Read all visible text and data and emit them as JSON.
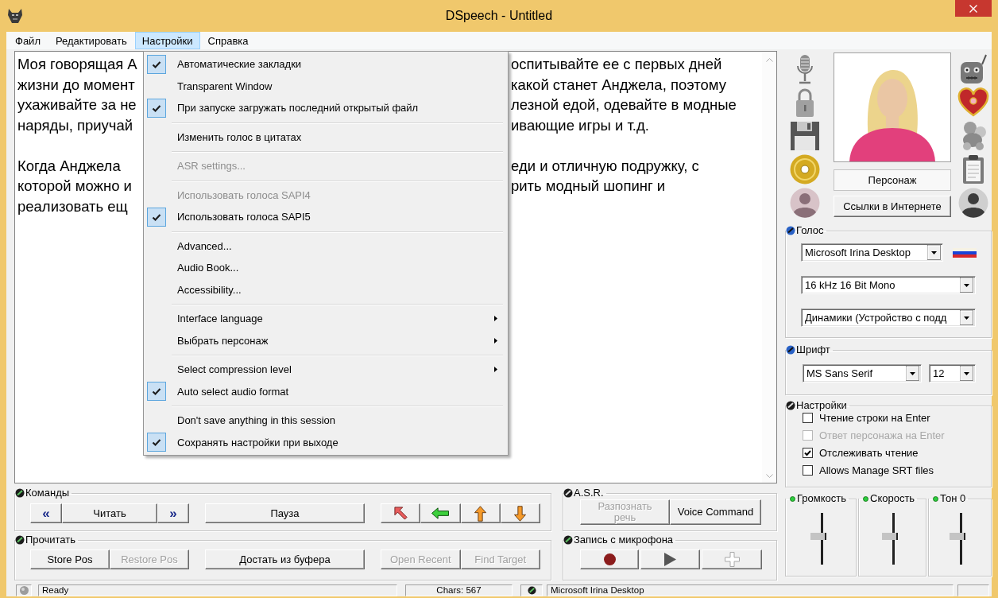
{
  "window": {
    "title": "DSpeech - Untitled"
  },
  "menu_bar": [
    {
      "label": "Файл",
      "selected": false
    },
    {
      "label": "Редактировать",
      "selected": false
    },
    {
      "label": "Настройки",
      "selected": true
    },
    {
      "label": "Справка",
      "selected": false
    }
  ],
  "open_menu": {
    "groups": [
      {
        "items": [
          {
            "label": "Автоматические закладки",
            "checked": true,
            "disabled": false,
            "submenu": false
          },
          {
            "label": "Transparent Window",
            "checked": false,
            "disabled": false,
            "submenu": false
          },
          {
            "label": "При запуске загружать последний открытый файл",
            "checked": true,
            "disabled": false,
            "submenu": false
          }
        ]
      },
      {
        "items": [
          {
            "label": "Изменить голос в цитатах",
            "checked": false,
            "disabled": false,
            "submenu": false
          }
        ]
      },
      {
        "items": [
          {
            "label": "ASR settings...",
            "checked": false,
            "disabled": true,
            "submenu": false
          }
        ]
      },
      {
        "items": [
          {
            "label": "Использовать голоса SAPI4",
            "checked": false,
            "disabled": true,
            "submenu": false
          },
          {
            "label": "Использовать голоса SAPI5",
            "checked": true,
            "disabled": false,
            "submenu": false
          }
        ]
      },
      {
        "items": [
          {
            "label": "Advanced...",
            "checked": false,
            "disabled": false,
            "submenu": false
          },
          {
            "label": "Audio Book...",
            "checked": false,
            "disabled": false,
            "submenu": false
          },
          {
            "label": "Accessibility...",
            "checked": false,
            "disabled": false,
            "submenu": false
          }
        ]
      },
      {
        "items": [
          {
            "label": "Interface language",
            "checked": false,
            "disabled": false,
            "submenu": true
          },
          {
            "label": "Выбрать персонаж",
            "checked": false,
            "disabled": false,
            "submenu": true
          }
        ]
      },
      {
        "items": [
          {
            "label": "Select compression level",
            "checked": false,
            "disabled": false,
            "submenu": true
          },
          {
            "label": "Auto select audio format",
            "checked": true,
            "disabled": false,
            "submenu": false
          }
        ]
      },
      {
        "items": [
          {
            "label": "Don't save anything in this session",
            "checked": false,
            "disabled": false,
            "submenu": false
          },
          {
            "label": "Сохранять настройки при выходе",
            "checked": true,
            "disabled": false,
            "submenu": false
          }
        ]
      }
    ]
  },
  "editor": {
    "paragraphs": [
      {
        "lines": [
          {
            "left": "Моя говорящая А",
            "right": "оспитывайте ее с первых дней"
          },
          {
            "left": "жизни до момент",
            "right": "какой станет Анджела, поэтому"
          },
          {
            "left": "ухаживайте за не",
            "right": "лезной едой, одевайте в модные"
          },
          {
            "left": "наряды, приучай",
            "right": "ивающие игры и т.д."
          }
        ]
      },
      {
        "lines": [
          {
            "left": "Когда Анджела",
            "right": "еди и отличную подружку, с"
          },
          {
            "left": "которой можно и",
            "right": "рить модный шопинг и"
          },
          {
            "left": "реализовать ещ"
          }
        ]
      }
    ]
  },
  "character": {
    "name": "Персонаж",
    "links_button": "Ссылки в Интернете"
  },
  "voice": {
    "title": "Голос",
    "voice": "Microsoft Irina Desktop",
    "audio_format": "16 kHz 16 Bit Mono",
    "output_device": "Динамики (Устройство с подд"
  },
  "font": {
    "title": "Шрифт",
    "family": "MS Sans Serif",
    "size": "12"
  },
  "settings": {
    "title": "Настройки",
    "options": [
      {
        "label": "Чтение строки на Enter",
        "checked": false,
        "disabled": false
      },
      {
        "label": "Ответ персонажа на Enter",
        "checked": false,
        "disabled": true
      },
      {
        "label": "Отслеживать чтение",
        "checked": true,
        "disabled": false
      },
      {
        "label": "Allows Manage SRT files",
        "checked": false,
        "disabled": false
      }
    ]
  },
  "sliders": [
    {
      "label": "Громкость",
      "level": 0.55
    },
    {
      "label": "Скорость",
      "level": 0.55
    },
    {
      "label": "Тон 0",
      "level": 0.55
    }
  ],
  "commands": {
    "title": "Команды",
    "buttons": [
      {
        "label": "«",
        "kind": "nav"
      },
      {
        "label": "Читать",
        "kind": "text"
      },
      {
        "label": "»",
        "kind": "nav"
      },
      {
        "label": "Пауза",
        "kind": "text"
      }
    ]
  },
  "read": {
    "title": "Прочитать",
    "buttons": [
      {
        "label": "Store Pos",
        "disabled": false
      },
      {
        "label": "Restore Pos",
        "disabled": true
      },
      {
        "label": "Достать из буфера",
        "disabled": false
      },
      {
        "label": "Open Recent",
        "disabled": true
      },
      {
        "label": "Find Target",
        "disabled": true
      }
    ]
  },
  "asr": {
    "title": "A.S.R.",
    "buttons": [
      {
        "label": "Разпознать речь",
        "disabled": true
      },
      {
        "label": "Voice Command",
        "disabled": false
      }
    ]
  },
  "recording": {
    "title": "Запись с микрофона",
    "add_disabled": true
  },
  "status_bar": {
    "message": "Ready",
    "chars": "Chars: 567",
    "voice": "Microsoft Irina Desktop"
  }
}
